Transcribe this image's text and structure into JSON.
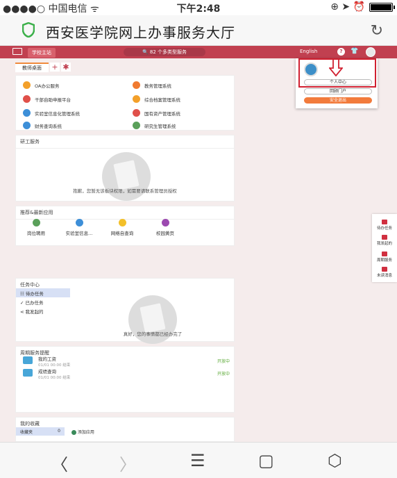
{
  "status_bar": {
    "carrier": "●●●●○ 中国电信 ᯤ",
    "time": "下午2:48",
    "right_icons": "⊕ ➤ ⏰"
  },
  "browser": {
    "title": "西安医学院网上办事服务大厅",
    "reload_icon": "↻"
  },
  "appbar": {
    "home_tab": "学校主站",
    "search_placeholder": "🔍 82 个多类型服务",
    "language": "English",
    "help": "?",
    "shirt": "👕"
  },
  "tabs": {
    "desk": "教师桌面",
    "add": "+",
    "settings": "✱"
  },
  "systems": [
    {
      "label": "OA办公服务",
      "color": "#f3a02a"
    },
    {
      "label": "教务管理系统",
      "color": "#f07a30"
    },
    {
      "label": "干部自助申报平台",
      "color": "#e0504a"
    },
    {
      "label": "综合档案管理系统",
      "color": "#f3a02a"
    },
    {
      "label": "实验室信息化管理系统",
      "color": "#3d8fd8"
    },
    {
      "label": "国有资产管理系统",
      "color": "#e0504a"
    },
    {
      "label": "财务查询系统",
      "color": "#3d8fd8"
    },
    {
      "label": "研究生管理系统",
      "color": "#5aa05a"
    }
  ],
  "research": {
    "title": "研工服务",
    "message": "抱歉，您暂无该板块权限，如需要请联系管理员授权"
  },
  "recommended": {
    "title": "推荐&最新应用",
    "apps": [
      {
        "label": "岗位聘用",
        "color": "#5aa05a"
      },
      {
        "label": "实验室信息...",
        "color": "#3d8fd8"
      },
      {
        "label": "网络自查询",
        "color": "#f3c02a"
      },
      {
        "label": "校园黄页",
        "color": "#9c4ab0"
      }
    ]
  },
  "tasks": {
    "title": "任务中心",
    "items": [
      "待办任务",
      "已办任务",
      "我发起的"
    ],
    "empty": "真好，您的事情都已经办完了"
  },
  "cycle": {
    "title": "周期服务提醒",
    "rows": [
      {
        "name": "我的工资",
        "date": "01/01 00:00 结束",
        "status": "开放中"
      },
      {
        "name": "成绩查询",
        "date": "01/01 00:00 结束",
        "status": "开放中"
      }
    ]
  },
  "favorites": {
    "title": "我的收藏",
    "folder": "收藏夹",
    "count": "0",
    "add": "添加应用"
  },
  "popup": {
    "personal": "个人中心",
    "portal": "回顾门户",
    "logout": "安全退出"
  },
  "right_tools": [
    "待办任务",
    "我发起的",
    "周期服务",
    "未读消息"
  ],
  "bottom": {
    "back": "〈",
    "forward": "〉",
    "menu": "☰",
    "share": "▢",
    "tabs": "⬡"
  }
}
